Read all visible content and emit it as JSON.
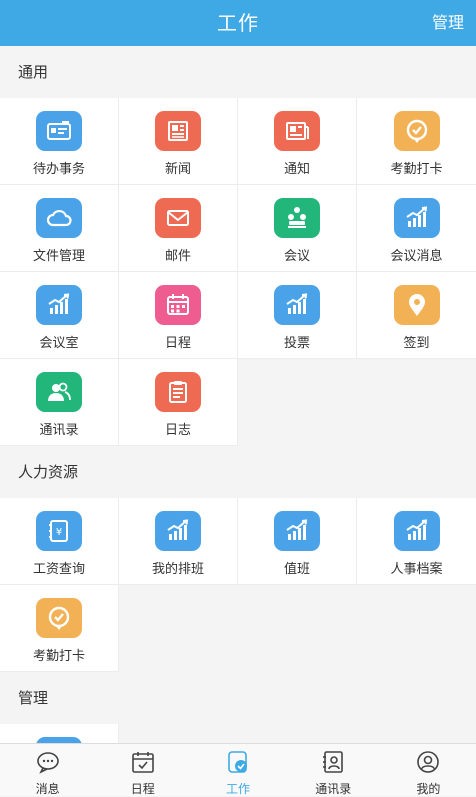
{
  "header": {
    "title": "工作",
    "manage": "管理"
  },
  "sections": [
    {
      "title": "通用",
      "items": [
        {
          "label": "待办事务",
          "icon": "todo-card-icon",
          "color": "#4aa3e8"
        },
        {
          "label": "新闻",
          "icon": "news-icon",
          "color": "#ee6a52"
        },
        {
          "label": "通知",
          "icon": "notice-icon",
          "color": "#ee6a52"
        },
        {
          "label": "考勤打卡",
          "icon": "clock-in-icon",
          "color": "#f3b156"
        },
        {
          "label": "文件管理",
          "icon": "cloud-icon",
          "color": "#4aa3e8"
        },
        {
          "label": "邮件",
          "icon": "mail-icon",
          "color": "#ee6a52"
        },
        {
          "label": "会议",
          "icon": "meeting-icon",
          "color": "#23b67b"
        },
        {
          "label": "会议消息",
          "icon": "chart-icon",
          "color": "#4aa3e8"
        },
        {
          "label": "会议室",
          "icon": "chart-icon",
          "color": "#4aa3e8"
        },
        {
          "label": "日程",
          "icon": "calendar-icon",
          "color": "#ef5c8f"
        },
        {
          "label": "投票",
          "icon": "chart-icon",
          "color": "#4aa3e8"
        },
        {
          "label": "签到",
          "icon": "location-icon",
          "color": "#f3b156"
        },
        {
          "label": "通讯录",
          "icon": "contacts-icon",
          "color": "#23b67b"
        },
        {
          "label": "日志",
          "icon": "log-icon",
          "color": "#ee6a52"
        }
      ]
    },
    {
      "title": "人力资源",
      "items": [
        {
          "label": "工资查询",
          "icon": "salary-icon",
          "color": "#4aa3e8"
        },
        {
          "label": "我的排班",
          "icon": "chart-icon",
          "color": "#4aa3e8"
        },
        {
          "label": "值班",
          "icon": "chart-icon",
          "color": "#4aa3e8"
        },
        {
          "label": "人事档案",
          "icon": "chart-icon",
          "color": "#4aa3e8"
        },
        {
          "label": "考勤打卡",
          "icon": "clock-in-icon",
          "color": "#f3b156"
        }
      ]
    },
    {
      "title": "管理",
      "items": [
        {
          "label": "",
          "icon": "chart-icon",
          "color": "#4aa3e8"
        }
      ]
    }
  ],
  "tabbar": {
    "items": [
      {
        "label": "消息",
        "icon": "message-icon",
        "active": false
      },
      {
        "label": "日程",
        "icon": "schedule-icon",
        "active": false
      },
      {
        "label": "工作",
        "icon": "work-icon",
        "active": true
      },
      {
        "label": "通讯录",
        "icon": "address-book-icon",
        "active": false
      },
      {
        "label": "我的",
        "icon": "profile-icon",
        "active": false
      }
    ],
    "active_color": "#3ea9e5"
  },
  "colors": {
    "primary": "#3ea9e5",
    "background": "#f4f4f4"
  }
}
